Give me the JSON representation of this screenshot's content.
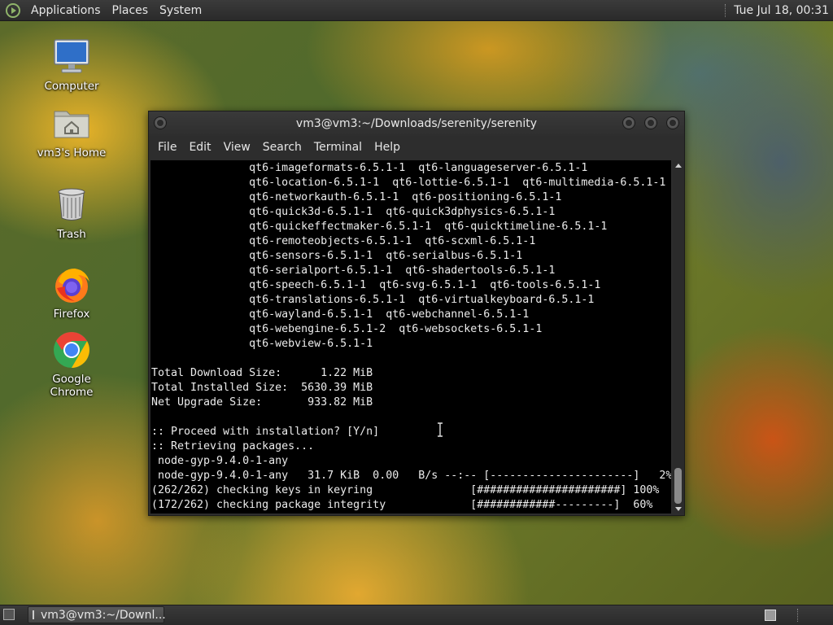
{
  "top_panel": {
    "menus": [
      "Applications",
      "Places",
      "System"
    ],
    "clock": "Tue Jul 18, 00:31"
  },
  "desktop_icons": [
    {
      "label": "Computer",
      "icon": "computer-icon"
    },
    {
      "label": "vm3's Home",
      "icon": "home-folder-icon"
    },
    {
      "label": "Trash",
      "icon": "trash-icon"
    },
    {
      "label": "Firefox",
      "icon": "firefox-icon"
    },
    {
      "label": "Google Chrome",
      "icon": "chrome-icon"
    }
  ],
  "terminal": {
    "title": "vm3@vm3:~/Downloads/serenity/serenity",
    "menus": [
      "File",
      "Edit",
      "View",
      "Search",
      "Terminal",
      "Help"
    ],
    "lines": [
      "               qt6-imageformats-6.5.1-1  qt6-languageserver-6.5.1-1",
      "               qt6-location-6.5.1-1  qt6-lottie-6.5.1-1  qt6-multimedia-6.5.1-1",
      "               qt6-networkauth-6.5.1-1  qt6-positioning-6.5.1-1",
      "               qt6-quick3d-6.5.1-1  qt6-quick3dphysics-6.5.1-1",
      "               qt6-quickeffectmaker-6.5.1-1  qt6-quicktimeline-6.5.1-1",
      "               qt6-remoteobjects-6.5.1-1  qt6-scxml-6.5.1-1",
      "               qt6-sensors-6.5.1-1  qt6-serialbus-6.5.1-1",
      "               qt6-serialport-6.5.1-1  qt6-shadertools-6.5.1-1",
      "               qt6-speech-6.5.1-1  qt6-svg-6.5.1-1  qt6-tools-6.5.1-1",
      "               qt6-translations-6.5.1-1  qt6-virtualkeyboard-6.5.1-1",
      "               qt6-wayland-6.5.1-1  qt6-webchannel-6.5.1-1",
      "               qt6-webengine-6.5.1-2  qt6-websockets-6.5.1-1",
      "               qt6-webview-6.5.1-1",
      "",
      "Total Download Size:      1.22 MiB",
      "Total Installed Size:  5630.39 MiB",
      "Net Upgrade Size:       933.82 MiB",
      "",
      ":: Proceed with installation? [Y/n]",
      ":: Retrieving packages...",
      " node-gyp-9.4.0-1-any",
      " node-gyp-9.4.0-1-any   31.7 KiB  0.00   B/s --:-- [----------------------]   2%",
      "(262/262) checking keys in keyring               [######################] 100%",
      "(172/262) checking package integrity             [############---------]  60%"
    ]
  },
  "taskbar": {
    "task_label": "vm3@vm3:~/Downl..."
  }
}
